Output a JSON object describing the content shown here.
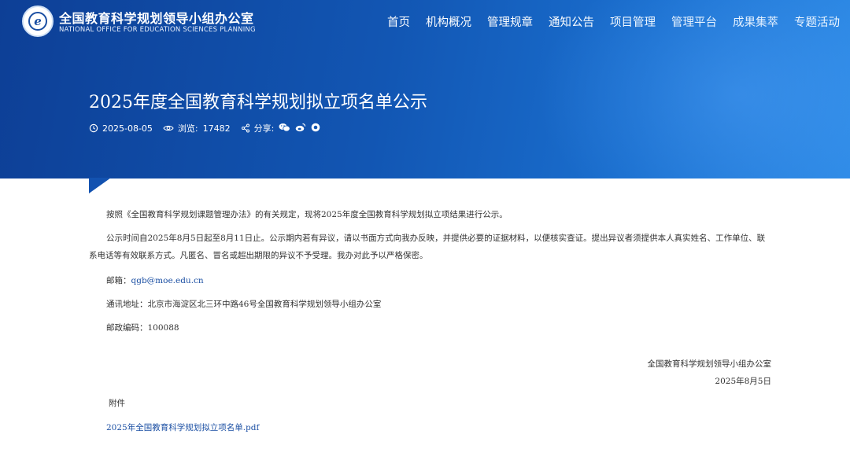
{
  "header": {
    "site_title": "全国教育科学规划领导小组办公室",
    "site_subtitle": "NATIONAL OFFICE FOR EDUCATION SCIENCES PLANNING",
    "nav": [
      "首页",
      "机构概况",
      "管理规章",
      "通知公告",
      "项目管理",
      "管理平台",
      "成果集萃",
      "专题活动"
    ]
  },
  "article": {
    "title": "2025年度全国教育科学规划拟立项名单公示",
    "date": "2025-08-05",
    "views_label": "浏览:",
    "views": "17482",
    "share_label": "分享:",
    "share_icons": [
      "wechat-icon",
      "weibo-icon",
      "qzone-icon"
    ]
  },
  "body": {
    "para1": "按照《全国教育科学规划课题管理办法》的有关规定，现将2025年度全国教育科学规划拟立项结果进行公示。",
    "para2": "公示时间自2025年8月5日起至8月11日止。公示期内若有异议，请以书面方式向我办反映，并提供必要的证据材料，以便核实查证。提出异议者须提供本人真实姓名、工作单位、联系电话等有效联系方式。凡匿名、冒名或超出期限的异议不予受理。我办对此予以严格保密。",
    "email_label": "邮箱：",
    "email": "qgb@moe.edu.cn",
    "address_label": "通讯地址：",
    "address": "北京市海淀区北三环中路46号全国教育科学规划领导小组办公室",
    "postcode_label": "邮政编码：",
    "postcode": "100088"
  },
  "signature": {
    "org": "全国教育科学规划领导小组办公室",
    "date": "2025年8月5日"
  },
  "attachment": {
    "label": "附件",
    "file": "2025年全国教育科学规划拟立项名单.pdf"
  }
}
